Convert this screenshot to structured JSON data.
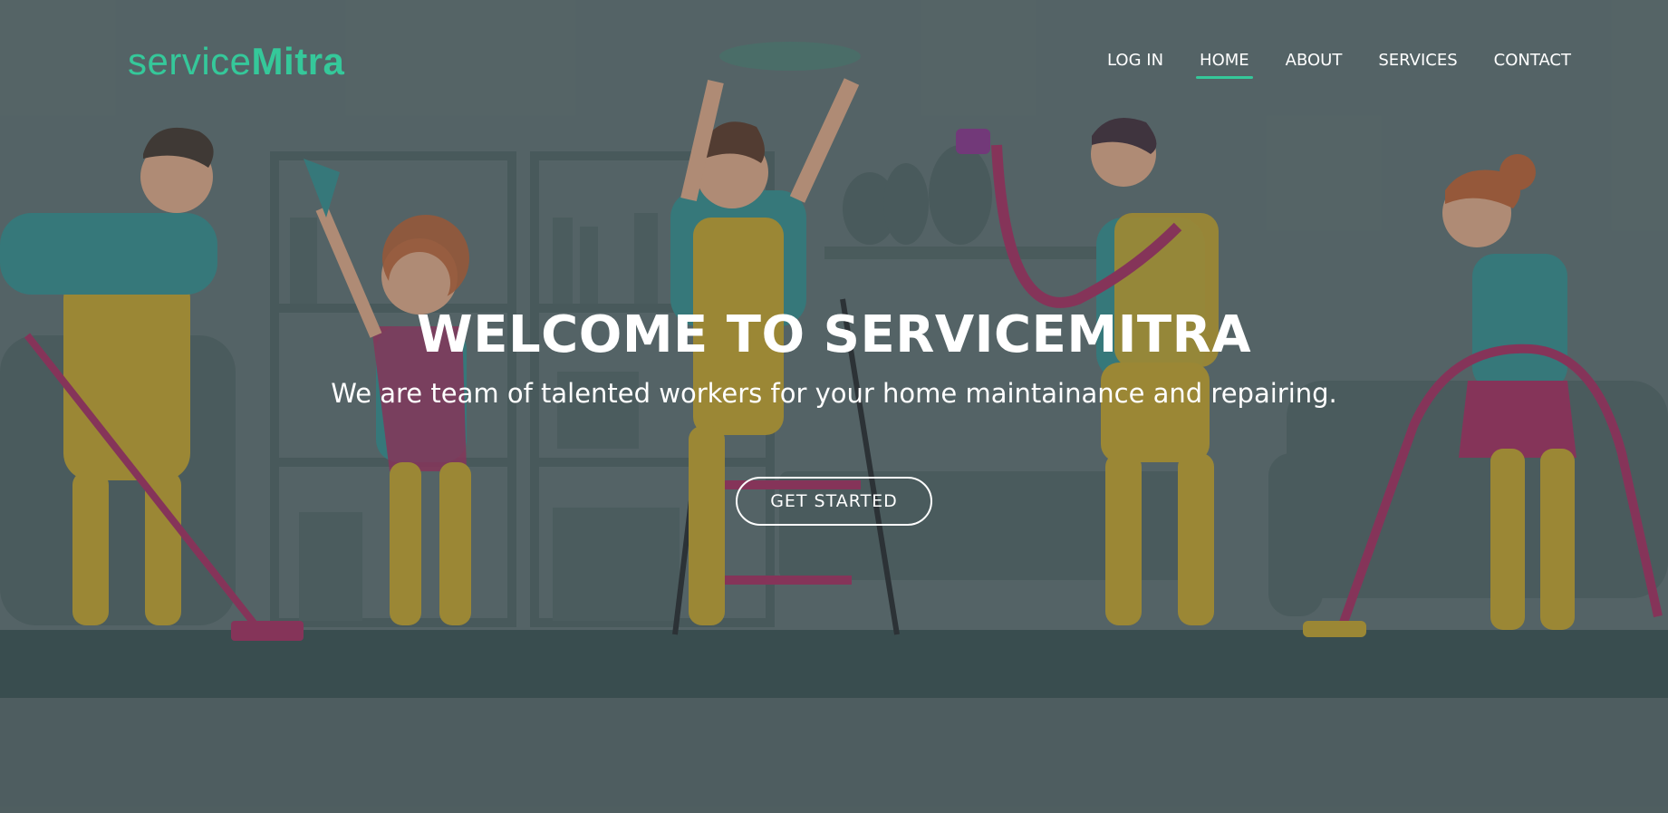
{
  "brand": {
    "logo_light": "service",
    "logo_bold": "Mitra",
    "accent_color": "#35c89a"
  },
  "nav": {
    "items": [
      {
        "label": "LOG IN"
      },
      {
        "label": "HOME",
        "active": true
      },
      {
        "label": "ABOUT"
      },
      {
        "label": "SERVICES"
      },
      {
        "label": "CONTACT"
      }
    ]
  },
  "hero": {
    "title": "WELCOME TO SERVICEMITRA",
    "subtitle": "We are team of talented workers for your home maintainance and repairing.",
    "cta_label": "GET STARTED"
  }
}
